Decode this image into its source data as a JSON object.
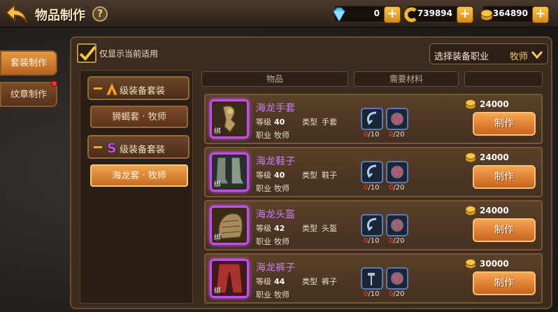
{
  "header": {
    "title": "物品制作",
    "help": "?"
  },
  "currency": {
    "diamond": "0",
    "gold_coin": "739894",
    "coin": "364890",
    "plus": "+"
  },
  "side_tabs": [
    {
      "label": "套装制作",
      "active": true
    },
    {
      "label": "纹章制作",
      "active": false,
      "badge": true
    }
  ],
  "filter": {
    "label": "仅显示当前适用",
    "checked": true,
    "job_select_label": "选择装备职业",
    "job_value": "牧师"
  },
  "categories": [
    {
      "grade": "A",
      "label": "级装备套装",
      "set": "狮蝎套 · 牧师",
      "selected": false
    },
    {
      "grade": "S",
      "label": "级装备套装",
      "set": "海龙套 · 牧师",
      "selected": true
    }
  ],
  "table_headers": {
    "item": "物品",
    "materials": "需要材料",
    "blank": ""
  },
  "items": [
    {
      "name": "海龙手套",
      "level_label": "等级",
      "level": "40",
      "job_label": "职业",
      "job": "牧师",
      "type_label": "类型",
      "type": "手套",
      "bind": "绑",
      "mat1_have": "0",
      "mat1_need": "/10",
      "mat2_have": "0",
      "mat2_need": "/20",
      "price": "24000",
      "button": "制作"
    },
    {
      "name": "海龙鞋子",
      "level_label": "等级",
      "level": "40",
      "job_label": "职业",
      "job": "牧师",
      "type_label": "类型",
      "type": "鞋子",
      "bind": "绑",
      "mat1_have": "0",
      "mat1_need": "/10",
      "mat2_have": "0",
      "mat2_need": "/20",
      "price": "24000",
      "button": "制作"
    },
    {
      "name": "海龙头盔",
      "level_label": "等级",
      "level": "42",
      "job_label": "职业",
      "job": "牧师",
      "type_label": "类型",
      "type": "头盔",
      "bind": "绑",
      "mat1_have": "0",
      "mat1_need": "/10",
      "mat2_have": "0",
      "mat2_need": "/20",
      "price": "24000",
      "button": "制作"
    },
    {
      "name": "海龙裤子",
      "level_label": "等级",
      "level": "44",
      "job_label": "职业",
      "job": "牧师",
      "type_label": "类型",
      "type": "裤子",
      "bind": "绑",
      "mat1_have": "0",
      "mat1_need": "/10",
      "mat2_have": "0",
      "mat2_need": "/20",
      "price": "30000",
      "button": "制作"
    }
  ],
  "colors": {
    "accent": "#f0a24c",
    "item_name": "#c77dff",
    "shortage": "#ff3a3a"
  }
}
